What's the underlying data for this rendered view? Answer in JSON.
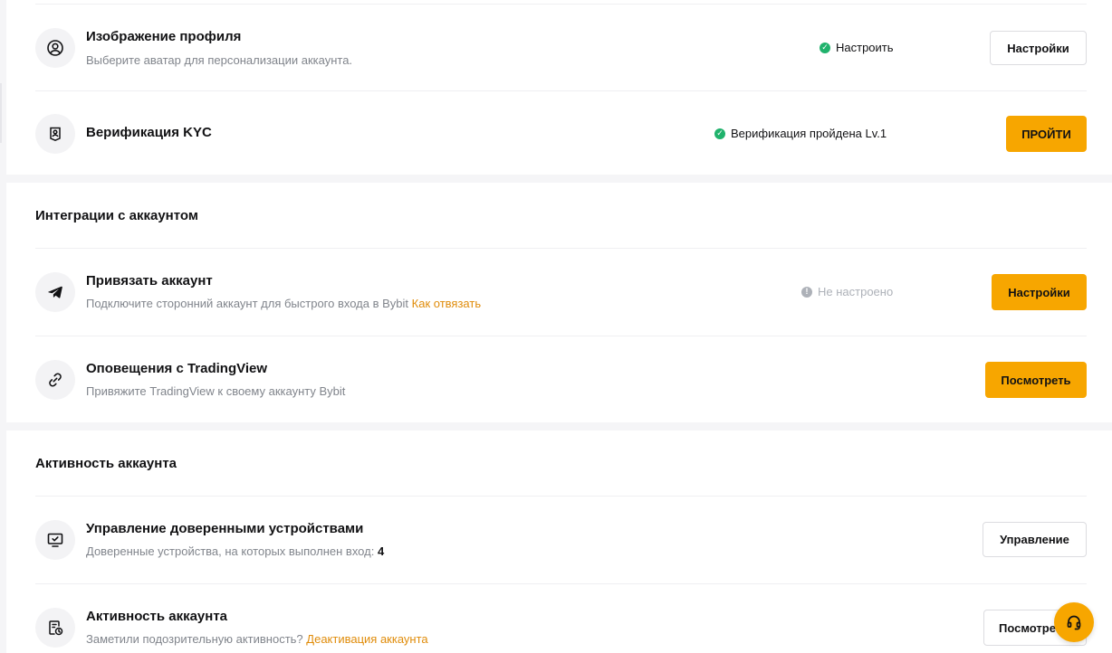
{
  "profile_section": {
    "avatar_row": {
      "title": "Изображение профиля",
      "description": "Выберите аватар для персонализации аккаунта.",
      "status": "Настроить",
      "button": "Настройки",
      "icon": "user-circle-icon"
    },
    "kyc_row": {
      "title": "Верификация KYC",
      "status": "Верификация пройдена Lv.1",
      "button": "ПРОЙТИ",
      "icon": "id-badge-icon"
    }
  },
  "integrations_section": {
    "title": "Интеграции с аккаунтом",
    "link_row": {
      "title": "Привязать аккаунт",
      "description": "Подключите сторонний аккаунт для быстрого входа в Bybit",
      "link": "Как отвязать",
      "status": "Не настроено",
      "button": "Настройки",
      "icon": "telegram-icon"
    },
    "tradingview_row": {
      "title": "Оповещения с TradingView",
      "description": "Привяжите TradingView к своему аккаунту Bybit",
      "button": "Посмотреть",
      "icon": "link-icon"
    }
  },
  "activity_section": {
    "title": "Активность аккаунта",
    "devices_row": {
      "title": "Управление доверенными устройствами",
      "description": "Доверенные устройства, на которых выполнен вход:",
      "count": "4",
      "button": "Управление",
      "icon": "monitor-check-icon"
    },
    "activity_row": {
      "title": "Активность аккаунта",
      "description": "Заметили подозрительную активность?",
      "link": "Деактивация аккаунта",
      "button": "Посмотреть",
      "icon": "document-clock-icon"
    }
  },
  "support": {
    "icon": "headset-icon"
  },
  "colors": {
    "accent": "#f7a600",
    "link": "#e08c0a",
    "success": "#20b26c",
    "muted": "#adb1b8"
  }
}
